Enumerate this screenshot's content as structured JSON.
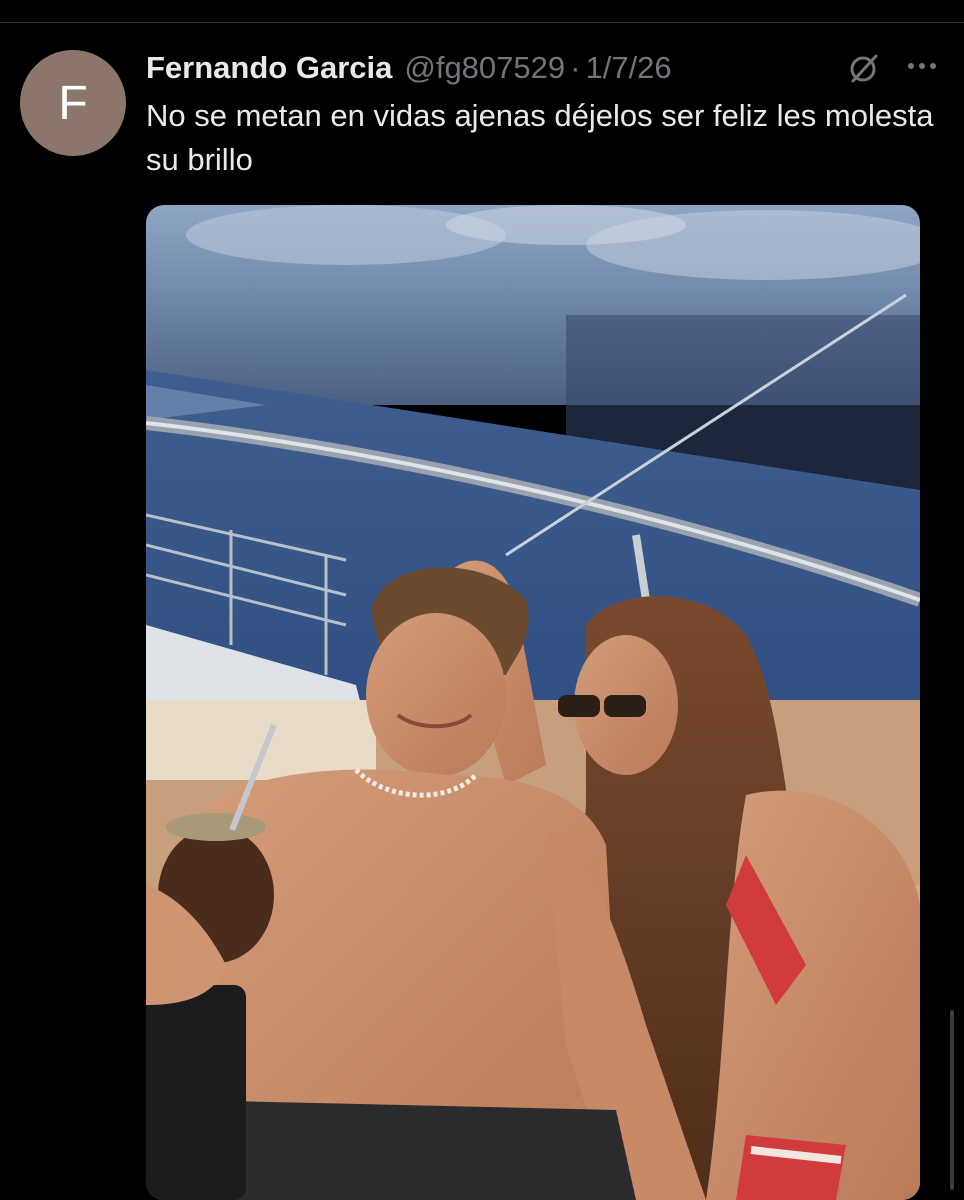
{
  "tweet": {
    "avatar_letter": "F",
    "author_name": "Fernando Garcia",
    "handle": "@fg807529",
    "separator": "·",
    "date": "1/7/26",
    "text": "No se metan en vidas ajenas déjelos ser feliz les molesta su brillo",
    "icons": [
      "grok-icon",
      "more-icon"
    ],
    "media": {
      "type": "photo",
      "description_icon": "photo-image"
    }
  },
  "colors": {
    "background": "#000000",
    "text_primary": "#e7e9ea",
    "text_secondary": "#71767b",
    "avatar_bg": "#8c756b",
    "divider": "#2f3336"
  }
}
